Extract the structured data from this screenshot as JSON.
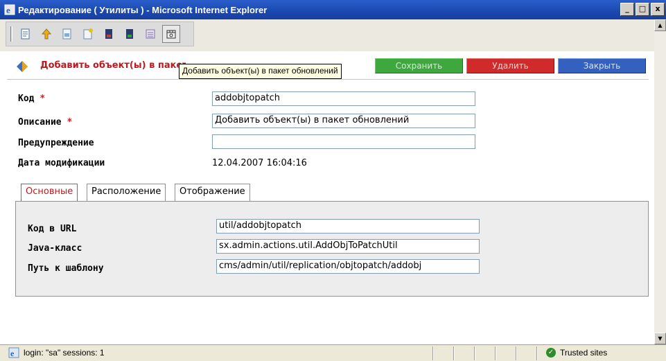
{
  "window": {
    "title": "Редактирование ( Утилиты ) - Microsoft Internet Explorer",
    "controls": {
      "minimize": "_",
      "maximize": "□",
      "close": "x"
    }
  },
  "toolbar": {
    "icons": [
      "new-page-icon",
      "up-icon",
      "document-icon",
      "document-star-icon",
      "bookmark-dark-icon",
      "bookmark-green-icon",
      "stack-icon",
      "package-icon"
    ]
  },
  "header": {
    "title": "Добавить объект(ы) в пакет обновлений",
    "tooltip": "Добавить объект(ы) в пакет обновлений",
    "buttons": {
      "save": "Сохранить",
      "delete": "Удалить",
      "close": "Закрыть"
    }
  },
  "form": {
    "code_label": "Код",
    "code_value": "addobjtopatch",
    "description_label": "Описание",
    "description_value": "Добавить объект(ы) в пакет обновлений",
    "warning_label": "Предупреждение",
    "warning_value": "",
    "modified_label": "Дата модификации",
    "modified_value": "12.04.2007 16:04:16",
    "required_mark": "*"
  },
  "tabs": [
    {
      "label": "Основные",
      "active": true
    },
    {
      "label": "Расположение",
      "active": false
    },
    {
      "label": "Отображение",
      "active": false
    }
  ],
  "tab_panel": {
    "url_code_label": "Код в URL",
    "url_code_value": "util/addobjtopatch",
    "java_class_label": "Java-класс",
    "java_class_value": "sx.admin.actions.util.AddObjToPatchUtil",
    "template_path_label": "Путь к шаблону",
    "template_path_value": "cms/admin/util/replication/objtopatch/addobj"
  },
  "statusbar": {
    "text": "login: \"sa\" sessions: 1",
    "zone": "Trusted sites"
  },
  "colors": {
    "title_red": "#c0181e",
    "save_green": "#3ea83e",
    "delete_red": "#d02a2a",
    "close_blue": "#3460c0"
  }
}
